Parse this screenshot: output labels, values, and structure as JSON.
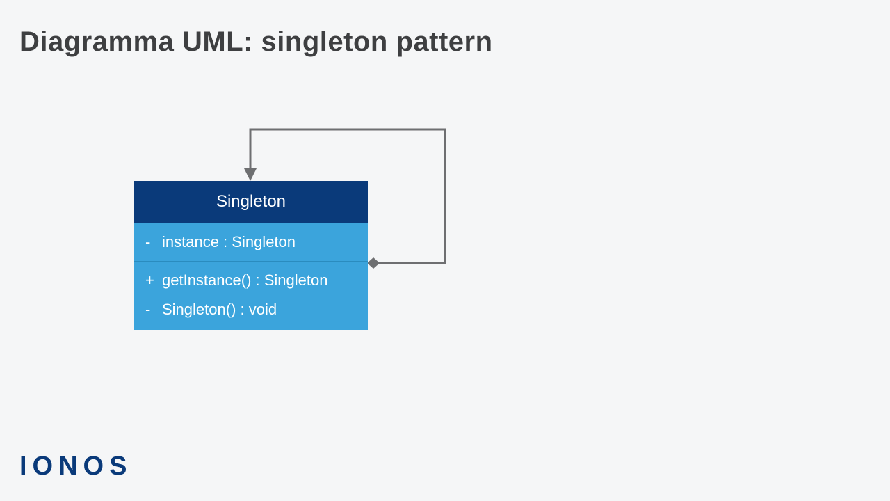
{
  "title": "Diagramma UML: singleton pattern",
  "uml": {
    "class_name": "Singleton",
    "attributes": [
      {
        "visibility": "-",
        "text": "instance : Singleton"
      }
    ],
    "operations": [
      {
        "visibility": "+",
        "text": "getInstance() : Singleton"
      },
      {
        "visibility": "-",
        "text": "Singleton() : void"
      }
    ]
  },
  "logo": "IONOS",
  "colors": {
    "bg": "#f5f6f7",
    "title": "#3e3f41",
    "class_header_bg": "#0a3a7a",
    "class_body_bg": "#3ba4dc",
    "connector": "#6e6f71",
    "logo": "#0a3a7a"
  }
}
